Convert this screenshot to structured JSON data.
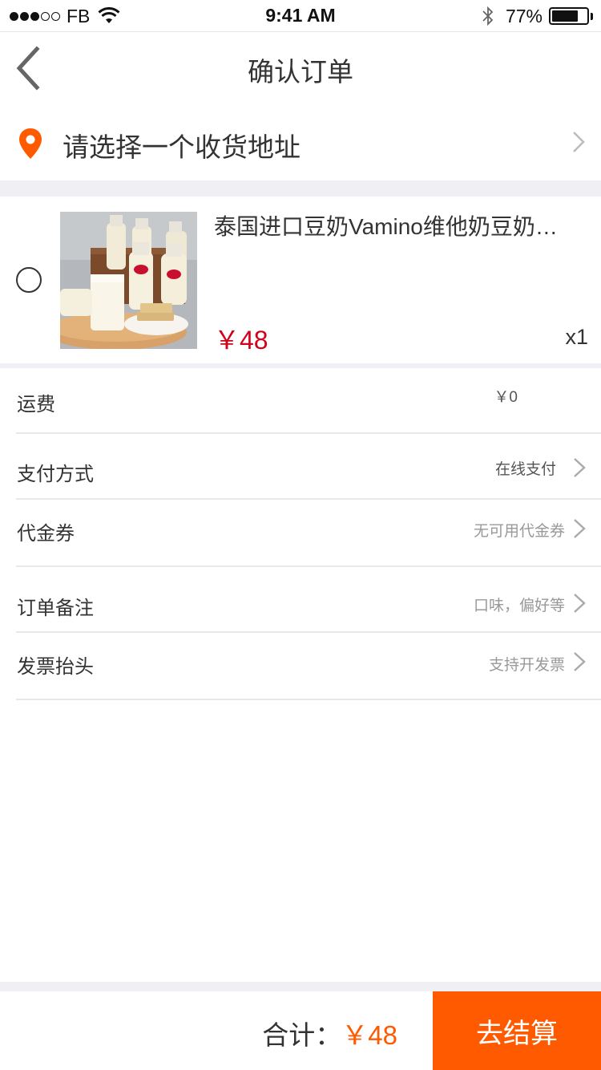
{
  "status_bar": {
    "carrier": "FB",
    "time": "9:41 AM",
    "battery_percent": "77%",
    "battery_level": 0.77
  },
  "nav": {
    "title": "确认订单",
    "back_icon": "chevron-left-icon"
  },
  "address": {
    "placeholder": "请选择一个收货地址",
    "icon": "location-pin-icon",
    "accent_color": "#ff5a00"
  },
  "product": {
    "name": "泰国进口豆奶Vamino维他奶豆奶…",
    "price": "￥48",
    "quantity": "x1",
    "price_color": "#d0021b"
  },
  "rows": {
    "shipping": {
      "label": "运费",
      "value": "￥0"
    },
    "payment": {
      "label": "支付方式",
      "value": "在线支付"
    },
    "coupon": {
      "label": "代金券",
      "value": "无可用代金券"
    },
    "remark": {
      "label": "订单备注",
      "value": "口味，偏好等"
    },
    "invoice": {
      "label": "发票抬头",
      "value": "支持开发票"
    }
  },
  "footer": {
    "total_label": "合计：",
    "total_amount": "￥48",
    "checkout_label": "去结算",
    "accent_color": "#ff5a00"
  }
}
